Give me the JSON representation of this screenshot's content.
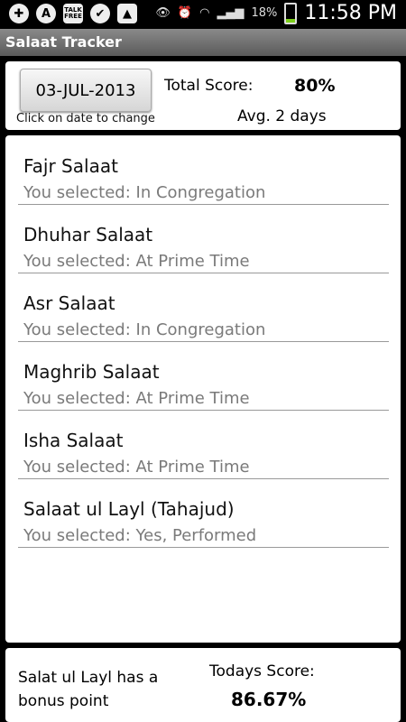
{
  "status_bar": {
    "icons": [
      {
        "name": "plus-icon",
        "glyph": "✚"
      },
      {
        "name": "app-a-icon",
        "glyph": "A"
      },
      {
        "name": "talk-free-icon",
        "glyph": "TALK FREE"
      },
      {
        "name": "check-icon",
        "glyph": "✔"
      },
      {
        "name": "image-icon",
        "glyph": "▲"
      }
    ],
    "battery_percent": "18%",
    "battery_level": 0.18,
    "time": "11:58 PM"
  },
  "app": {
    "title": "Salaat Tracker"
  },
  "header": {
    "date": "03-JUL-2013",
    "date_hint": "Click on date to change",
    "total_label": "Total Score:",
    "total_value": "80%",
    "avg": "Avg. 2 days"
  },
  "salaat_list": [
    {
      "title": "Fajr Salaat",
      "selection": "You selected: In Congregation"
    },
    {
      "title": "Dhuhar Salaat",
      "selection": "You selected: At Prime Time"
    },
    {
      "title": "Asr Salaat",
      "selection": "You selected: In Congregation"
    },
    {
      "title": "Maghrib Salaat",
      "selection": "You selected: At Prime Time"
    },
    {
      "title": "Isha Salaat",
      "selection": "You selected: At Prime Time"
    },
    {
      "title": "Salaat ul Layl (Tahajud)",
      "selection": "You selected: Yes, Performed"
    }
  ],
  "footer": {
    "bonus_note": "Salat ul Layl has a bonus point",
    "today_label": "Todays Score:",
    "today_value": "86.67%"
  },
  "colors": {
    "title_bar": "#6e6e6e",
    "subtext": "#7a7a7a",
    "battery": "#7ccf1a"
  }
}
